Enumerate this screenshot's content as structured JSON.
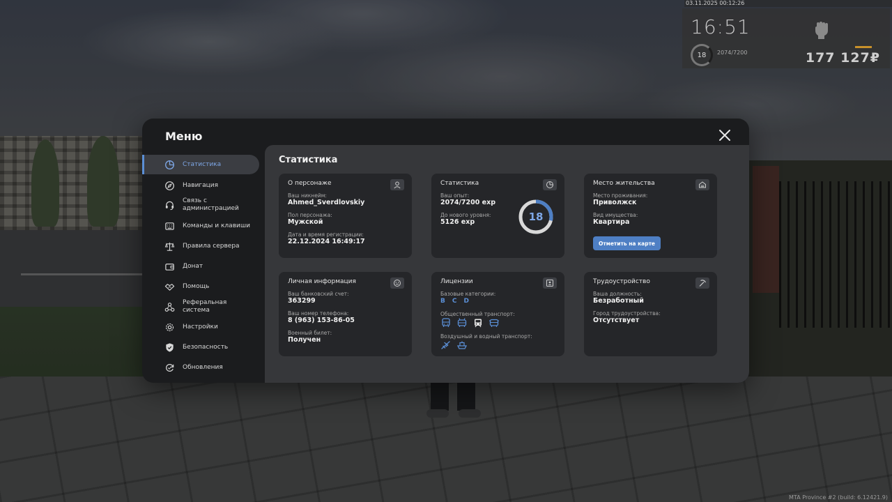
{
  "hud": {
    "datetime": "03.11.2025 00:12:26",
    "time": "16:51",
    "level": "18",
    "exp": "2074/7200",
    "money": "177 127₽"
  },
  "build_info": "MTA Province #2 (build: 6.12421.9)",
  "menu": {
    "title": "Меню",
    "sidebar": [
      {
        "label": "Статистика",
        "icon": "pie-chart-icon",
        "active": true
      },
      {
        "label": "Навигация",
        "icon": "compass-icon",
        "active": false
      },
      {
        "label": "Связь с администрацией",
        "icon": "headset-icon",
        "active": false
      },
      {
        "label": "Команды и клавиши",
        "icon": "keyboard-icon",
        "active": false
      },
      {
        "label": "Правила сервера",
        "icon": "scales-icon",
        "active": false
      },
      {
        "label": "Донат",
        "icon": "wallet-icon",
        "active": false
      },
      {
        "label": "Помощь",
        "icon": "handshake-icon",
        "active": false
      },
      {
        "label": "Реферальная система",
        "icon": "network-icon",
        "active": false
      },
      {
        "label": "Настройки",
        "icon": "gear-icon",
        "active": false
      },
      {
        "label": "Безопасность",
        "icon": "shield-icon",
        "active": false
      },
      {
        "label": "Обновления",
        "icon": "refresh-icon",
        "active": false
      }
    ],
    "content_title": "Статистика",
    "cards": {
      "character": {
        "title": "О персонаже",
        "nickname_label": "Ваш никнейм:",
        "nickname": "Ahmed_Sverdlovskiy",
        "gender_label": "Пол персонажа:",
        "gender": "Мужской",
        "reg_label": "Дата и время регистрации:",
        "reg": "22.12.2024 16:49:17"
      },
      "stats": {
        "title": "Статистика",
        "exp_label": "Ваш опыт:",
        "exp": "2074/7200 exp",
        "next_label": "До нового уровня:",
        "next": "5126 exp",
        "level": "18",
        "progress": 0.288
      },
      "residence": {
        "title": "Место жительства",
        "place_label": "Место проживания:",
        "place": "Приволжск",
        "property_label": "Вид имущества:",
        "property": "Квартира",
        "map_button": "Отметить на карте"
      },
      "personal": {
        "title": "Личная информация",
        "bank_label": "Ваш банковский счет:",
        "bank": "363299",
        "phone_label": "Ваш номер телефона:",
        "phone": "8 (963) 153-86-05",
        "military_label": "Военный билет:",
        "military": "Получен"
      },
      "licenses": {
        "title": "Лицензии",
        "basic_label": "Базовые категории:",
        "categories": [
          "B",
          "C",
          "D"
        ],
        "public_label": "Общественный транспорт:",
        "air_label": "Воздушный и водный транспорт:"
      },
      "employment": {
        "title": "Трудоустройство",
        "position_label": "Ваша должность:",
        "position": "Безработный",
        "city_label": "Город трудоустройства:",
        "city": "Отсутствует"
      }
    }
  },
  "colors": {
    "accent": "#5b8fd6",
    "button": "#4e7fc4",
    "panel": "#252629",
    "window": "#1b1c1e"
  }
}
